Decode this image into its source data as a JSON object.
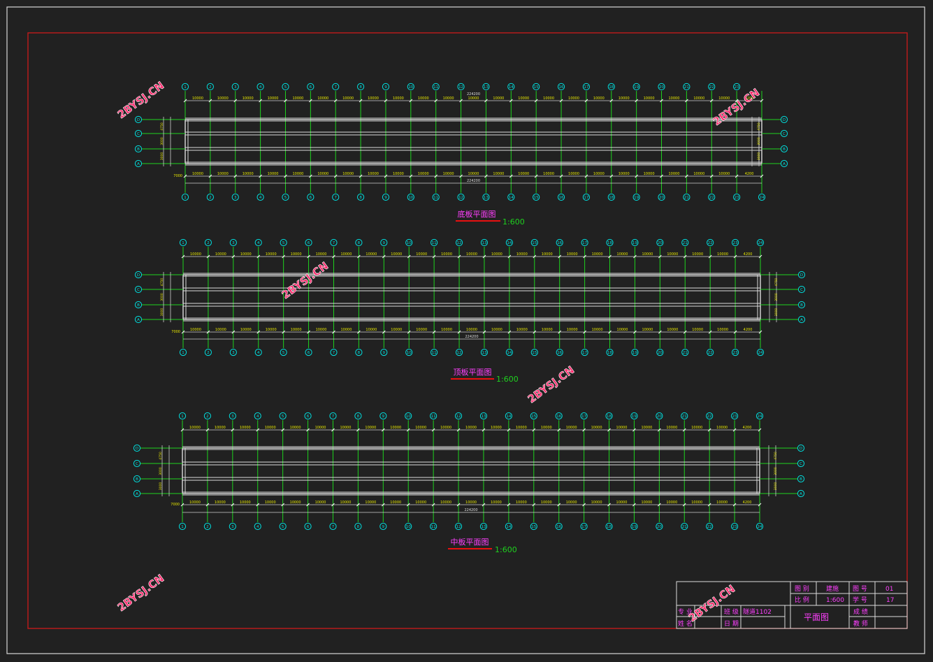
{
  "plans": [
    {
      "title": "底板平面图",
      "scale": "1:600",
      "axes_top": [
        "1",
        "2",
        "3",
        "4",
        "5",
        "6",
        "7",
        "8",
        "9",
        "10",
        "11",
        "12",
        "13",
        "14",
        "15",
        "16",
        "17",
        "18",
        "19",
        "20",
        "21",
        "22",
        "23"
      ],
      "axes_bottom": [
        "1",
        "2",
        "3",
        "4",
        "5",
        "6",
        "7",
        "8",
        "9",
        "10",
        "11",
        "12",
        "13",
        "14",
        "15",
        "16",
        "17",
        "18",
        "19",
        "20",
        "21",
        "22",
        "23",
        "24"
      ],
      "rows": [
        "D",
        "C",
        "B",
        "A"
      ],
      "total_dim": "224200",
      "bay_dim": "10000",
      "end_dim_left": "7000",
      "end_dim_right": "4200",
      "side_dims": [
        "4750",
        "3000",
        "3000",
        "4750"
      ]
    },
    {
      "title": "顶板平面图",
      "scale": "1:600",
      "axes_top": [
        "1",
        "2",
        "3",
        "4",
        "5",
        "6",
        "7",
        "8",
        "9",
        "10",
        "11",
        "12",
        "13",
        "14",
        "15",
        "16",
        "17",
        "18",
        "19",
        "20",
        "21",
        "22",
        "23",
        "24"
      ],
      "axes_bottom": [
        "1",
        "2",
        "3",
        "4",
        "5",
        "6",
        "7",
        "8",
        "9",
        "10",
        "11",
        "12",
        "13",
        "14",
        "15",
        "16",
        "17",
        "18",
        "19",
        "20",
        "21",
        "22",
        "23",
        "24"
      ],
      "rows": [
        "D",
        "C",
        "B",
        "A"
      ],
      "total_dim": "224200",
      "bay_dim": "10000",
      "end_dim_left": "7000",
      "end_dim_right": "4200",
      "side_dims": [
        "4750",
        "3000",
        "3000",
        "4750"
      ]
    },
    {
      "title": "中板平面图",
      "scale": "1:600",
      "axes_top": [
        "1",
        "2",
        "3",
        "4",
        "5",
        "6",
        "7",
        "8",
        "9",
        "10",
        "11",
        "12",
        "13",
        "14",
        "15",
        "16",
        "17",
        "18",
        "19",
        "20",
        "21",
        "22",
        "23",
        "24"
      ],
      "axes_bottom": [
        "1",
        "2",
        "3",
        "4",
        "5",
        "6",
        "7",
        "8",
        "9",
        "10",
        "11",
        "12",
        "13",
        "14",
        "15",
        "16",
        "17",
        "18",
        "19",
        "20",
        "21",
        "22",
        "23",
        "24"
      ],
      "rows": [
        "D",
        "C",
        "B",
        "A"
      ],
      "total_dim": "224200",
      "bay_dim": "10000",
      "end_dim_left": "7000",
      "end_dim_right": "4200",
      "side_dims": [
        "4750",
        "3000",
        "3000",
        "4750"
      ]
    }
  ],
  "watermark": "2BYSJ.CN",
  "title_block": {
    "drawing_type_label": "图 别",
    "drawing_type_value": "建施",
    "drawing_no_label": "图 号",
    "drawing_no_value": "01",
    "scale_label": "比 例",
    "scale_value": "1:600",
    "student_no_label": "学 号",
    "student_no_value": "17",
    "major_label": "专 业",
    "class_label": "班 级",
    "class_value": "隧道1102",
    "score_label": "成 绩",
    "drawing_title": "平面图",
    "name_label": "姓 名",
    "date_label": "日 期",
    "teacher_label": "教 师"
  },
  "colors": {
    "background": "#212121",
    "frame": "#cc1a1a",
    "outer_frame": "#dddddd",
    "axis_circle": "#00dede",
    "grid_line": "#1ed21e",
    "dim_text": "#e8e800",
    "wall": "#dcdcdc",
    "title_text": "#ff40ff",
    "scale_text": "#1ed21e",
    "title_underline": "#e81010"
  }
}
